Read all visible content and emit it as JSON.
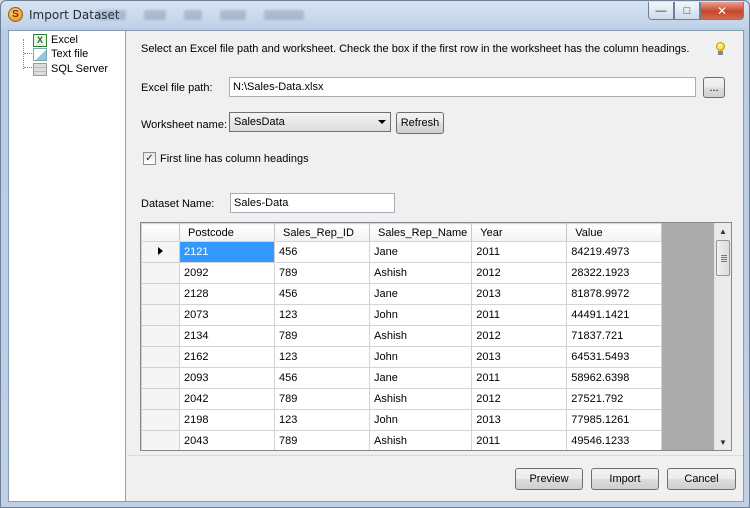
{
  "window": {
    "title": "Import Dataset"
  },
  "sidebar": {
    "items": [
      {
        "label": "Excel",
        "icon": "excel-icon"
      },
      {
        "label": "Text file",
        "icon": "text-file-icon"
      },
      {
        "label": "SQL Server",
        "icon": "sql-server-icon"
      }
    ]
  },
  "main": {
    "instructions": "Select an Excel file path and worksheet. Check the box if the first row in the worksheet has the column headings.",
    "excel_path_label": "Excel file path:",
    "excel_path_value": "N:\\Sales-Data.xlsx",
    "browse_label": "...",
    "worksheet_label": "Worksheet name:",
    "worksheet_value": "SalesData",
    "refresh_label": "Refresh",
    "first_line_label": "First line has column headings",
    "first_line_checked": true,
    "dataset_name_label": "Dataset Name:",
    "dataset_name_value": "Sales-Data"
  },
  "grid": {
    "columns": [
      "Postcode",
      "Sales_Rep_ID",
      "Sales_Rep_Name",
      "Year",
      "Value"
    ],
    "rows": [
      [
        "2121",
        "456",
        "Jane",
        "2011",
        "84219.4973"
      ],
      [
        "2092",
        "789",
        "Ashish",
        "2012",
        "28322.1923"
      ],
      [
        "2128",
        "456",
        "Jane",
        "2013",
        "81878.9972"
      ],
      [
        "2073",
        "123",
        "John",
        "2011",
        "44491.1421"
      ],
      [
        "2134",
        "789",
        "Ashish",
        "2012",
        "71837.721"
      ],
      [
        "2162",
        "123",
        "John",
        "2013",
        "64531.5493"
      ],
      [
        "2093",
        "456",
        "Jane",
        "2011",
        "58962.6398"
      ],
      [
        "2042",
        "789",
        "Ashish",
        "2012",
        "27521.792"
      ],
      [
        "2198",
        "123",
        "John",
        "2013",
        "77985.1261"
      ],
      [
        "2043",
        "789",
        "Ashish",
        "2011",
        "49546.1233"
      ]
    ],
    "selected_row": 0
  },
  "footer": {
    "preview_label": "Preview",
    "import_label": "Import",
    "cancel_label": "Cancel"
  }
}
